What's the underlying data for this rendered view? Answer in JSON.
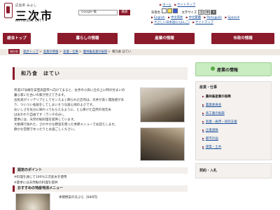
{
  "header": {
    "logo_small": "広島県 みよし",
    "logo_big": "三次市",
    "logo_en": "MIYOSHI CITY",
    "search_value": "Google 検",
    "search_button": "検索",
    "util": {
      "fontsize_label": "文字サイズ",
      "fontsize_buttons": [
        "小",
        "中",
        "大"
      ],
      "color_label": "背景色",
      "links1": [
        "ホーム",
        "サイトマップ"
      ],
      "languages": [
        "English",
        "中文简体",
        "中文繁體",
        "Português",
        "Spanish"
      ],
      "links2": [
        "やさしい日本語(にほんご)",
        "サイトマップ"
      ]
    }
  },
  "nav": [
    "総合トップ",
    "暮らしの情報",
    "産業の情報",
    "市政の情報"
  ],
  "breadcrumb": {
    "tag": "現在地",
    "items": [
      "総合トップ",
      "産業の情報",
      "産業・仕事",
      "農林畜産業の振興",
      "和乃食 ほてい"
    ]
  },
  "main": {
    "title": "和乃食　ほてい",
    "desc": [
      "県道37号線を安芸高田市へ向けてまると、左手の小高い丘の上に時の付まいの",
      "暮ら家いた古いの家が見えてきます。",
      "古民具がインテリアとしてセンスよく飾られた店内は、天井が高く開放感があ",
      "り、ついつい長居をしてしまいそうな居心地のよさです。",
      "おいしさを気分に味わってもらえるように、と心掛けた自然の地元米",
      "はおかわり自由です（ランチのみ）。",
      "夏季には、天然の鮎料理を提供しています。",
      "大根畑で採れた、さわやかな野菜を使った季節メニューでお迎えします。",
      "静かな空間でゆったりとお過ごしください。"
    ],
    "points_title": "認定のポイント",
    "points": [
      "※料理を通じて100％三次産米を使用",
      "※夏季には天然鮎の料理を提供"
    ],
    "menu_title": "おすすめの地産地消メニュー",
    "menu_item": "季節野菜の天ぷら［680円］"
  },
  "sidebar": {
    "head": "産業の情報",
    "category": "産業・仕事",
    "items": [
      {
        "label": "農林畜産業の振興",
        "active": true
      },
      {
        "label": "農業委員会",
        "active": false
      },
      {
        "label": "商工業の振興",
        "active": false
      },
      {
        "label": "就業・雇用・研究支援",
        "active": false
      },
      {
        "label": "企業誘致",
        "active": false
      },
      {
        "label": "都市計画",
        "active": false
      },
      {
        "label": "建築・土木",
        "active": false
      }
    ],
    "category2": "契約・入札"
  },
  "colors": {
    "brand": "#8b1a2b",
    "side_head": "#c9ecc0",
    "link": "#1a4f9c"
  }
}
